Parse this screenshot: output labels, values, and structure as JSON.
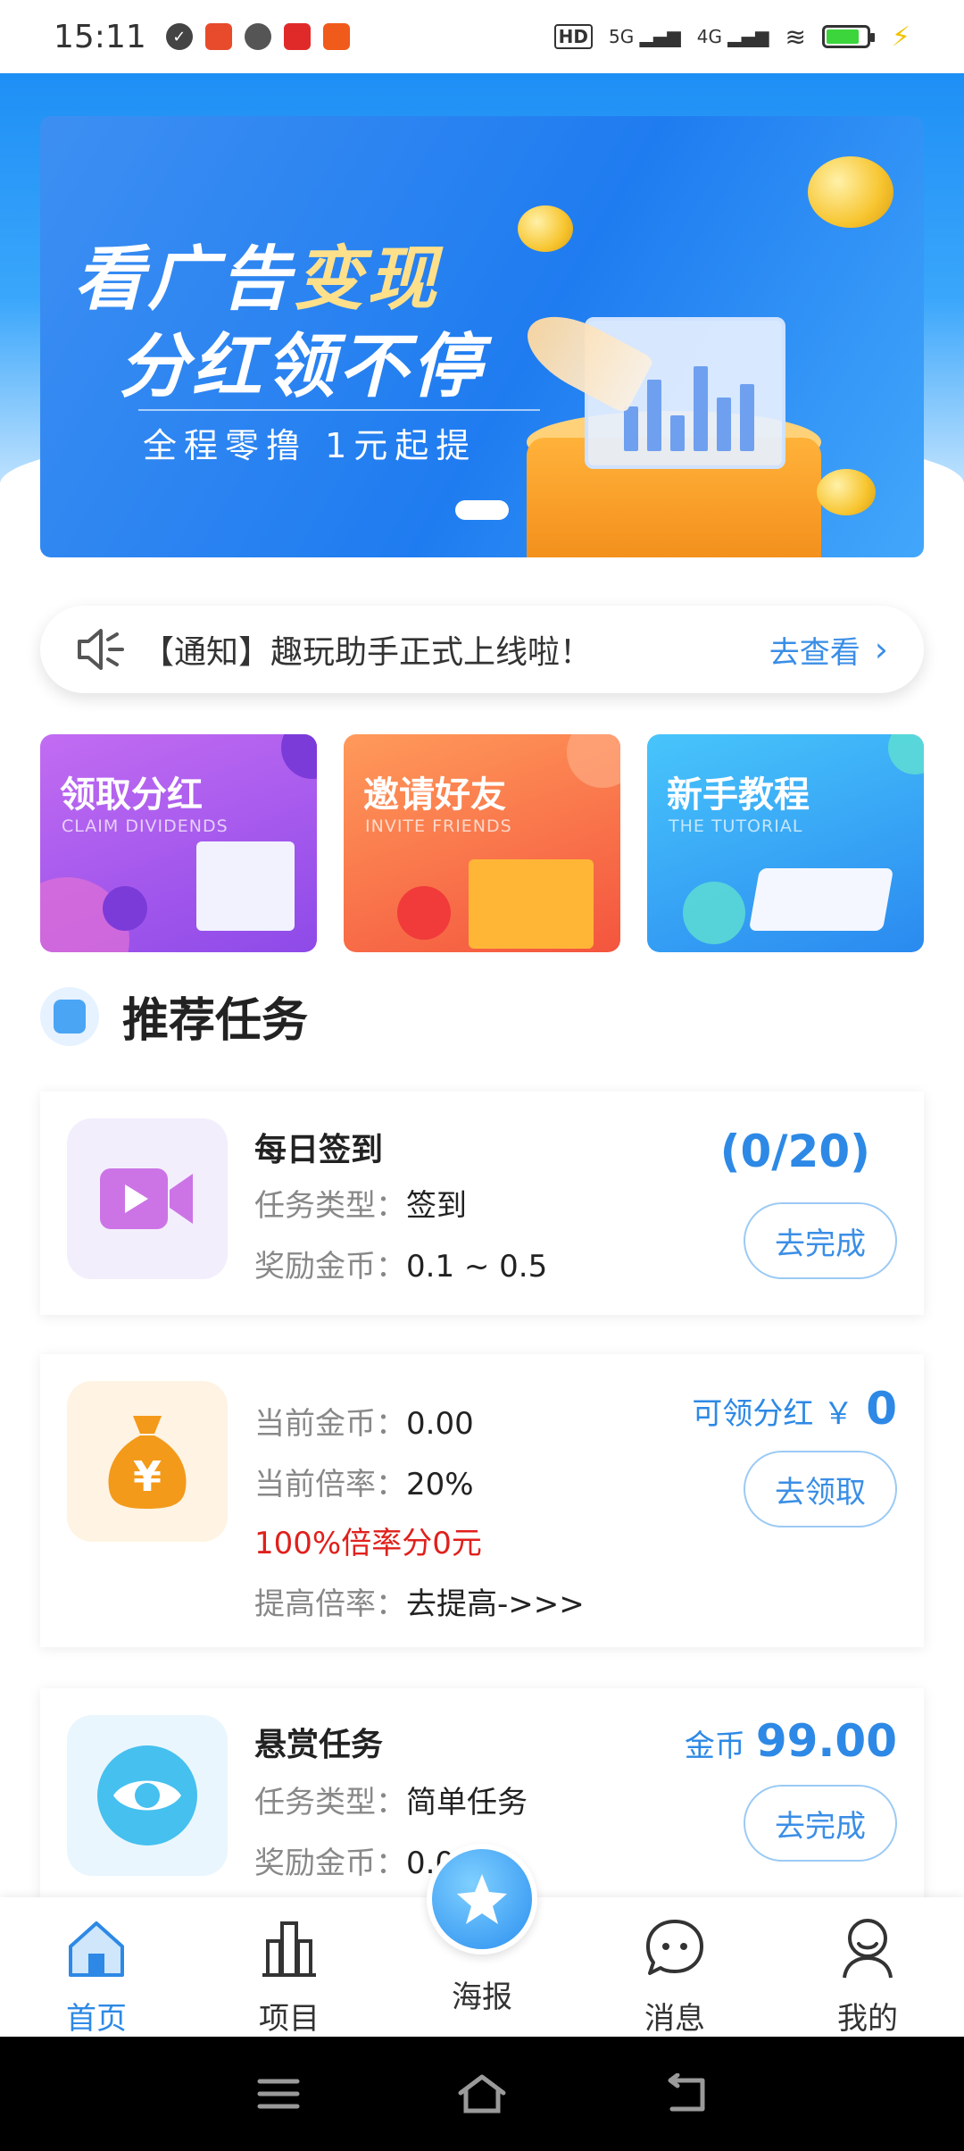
{
  "status_bar": {
    "time": "15:11",
    "right_labels": [
      "HD",
      "5G",
      "4G"
    ]
  },
  "banner": {
    "line1_a": "看广告",
    "line1_b": "变现",
    "line2": "分红领不停",
    "line3": "全程零撸 1元起提"
  },
  "notice": {
    "text": "【通知】趣玩助手正式上线啦！",
    "action": "去查看"
  },
  "features": [
    {
      "title": "领取分红",
      "subtitle": "CLAIM DIVIDENDS"
    },
    {
      "title": "邀请好友",
      "subtitle": "INVITE FRIENDS"
    },
    {
      "title": "新手教程",
      "subtitle": "THE TUTORIAL"
    }
  ],
  "section": {
    "title": "推荐任务"
  },
  "tasks": {
    "checkin": {
      "name": "每日签到",
      "type_label": "任务类型：",
      "type_value": "签到",
      "reward_label": "奖励金币：",
      "reward_value": "0.1 ~ 0.5",
      "progress": "(0/20)",
      "button": "去完成"
    },
    "dividend": {
      "coins_label": "当前金币：",
      "coins_value": "0.00",
      "rate_label": "当前倍率：",
      "rate_value": "20%",
      "note": "100%倍率分0元",
      "raise_label": "提高倍率：",
      "raise_value": "去提高->>>",
      "claim_label": "可领分红 ￥",
      "claim_value": "0",
      "button": "去领取"
    },
    "bounty": {
      "name": "悬赏任务",
      "type_label": "任务类型：",
      "type_value": "简单任务",
      "reward_label": "奖励金币：",
      "reward_value": "0.00",
      "coin_label": "金币",
      "coin_value": "99.00",
      "button": "去完成"
    }
  },
  "tabbar": {
    "home": "首页",
    "projects": "项目",
    "poster": "海报",
    "messages": "消息",
    "mine": "我的"
  },
  "colors": {
    "accent": "#2d89e5",
    "warning": "#e0201c"
  }
}
